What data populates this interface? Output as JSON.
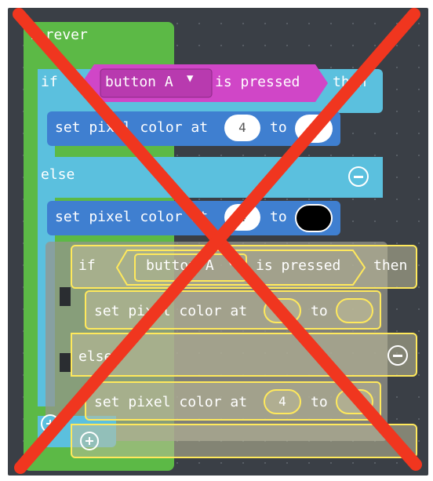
{
  "forever": {
    "label": "forever"
  },
  "if_block": {
    "if_label": "if",
    "then_label": "then",
    "else_label": "else"
  },
  "condition": {
    "button_label": "button A",
    "is_pressed_label": "is pressed",
    "dropdown_icon": "caret-down"
  },
  "set_pixel_1": {
    "label": "set pixel color at",
    "index": "4",
    "to_label": "to",
    "color": "#ffffff"
  },
  "set_pixel_2": {
    "label": "set pixel color at",
    "index": "4",
    "to_label": "to",
    "color": "#000000"
  },
  "ghost": {
    "if_label": "if",
    "then_label": "then",
    "else_label": "else",
    "button_label": "button A",
    "is_pressed_label": "is pressed",
    "set1_label": "set pixel color at",
    "set1_to": "to",
    "set2_label": "set pixel color at",
    "set2_index": "4",
    "set2_to": "to"
  },
  "colors": {
    "forever": "#5cb946",
    "logic": "#5bc0de",
    "input": "#d046c7",
    "set": "#3f7fd0",
    "ghost_outline": "#ffe95c",
    "cross": "#f0361f"
  },
  "icons": [
    "minus-circle-icon",
    "plus-circle-icon",
    "caret-down-icon",
    "cross-out-icon"
  ]
}
